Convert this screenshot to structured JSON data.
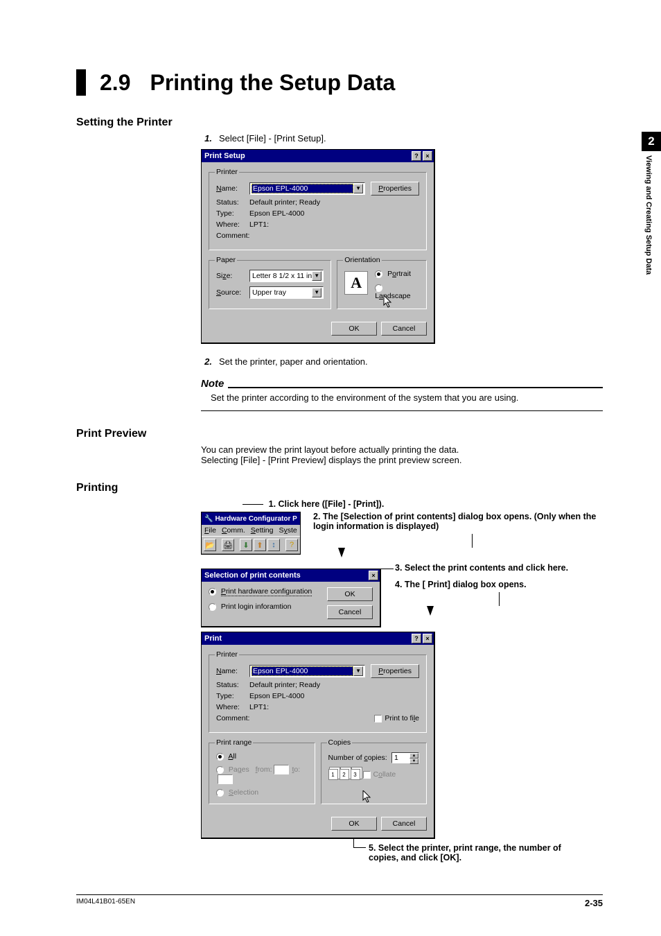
{
  "sidebar": {
    "chapter": "2",
    "chapter_name": "Viewing and Creating Setup Data"
  },
  "heading": {
    "number": "2.9",
    "title": "Printing the Setup Data"
  },
  "setting": {
    "h": "Setting the Printer",
    "step1_num": "1.",
    "step1_txt": "Select [File] - [Print Setup].",
    "step2_num": "2.",
    "step2_txt": "Set the printer, paper and orientation.",
    "note_label": "Note",
    "note_text": "Set the printer according to the environment of the system that you are using."
  },
  "print_setup_dlg": {
    "title": "Print Setup",
    "grp_printer": "Printer",
    "name_lbl": "Name:",
    "name_val": "Epson EPL-4000",
    "status_lbl": "Status:",
    "status_val": "Default printer; Ready",
    "type_lbl": "Type:",
    "type_val": "Epson EPL-4000",
    "where_lbl": "Where:",
    "where_val": "LPT1:",
    "comment_lbl": "Comment:",
    "properties_btn": "Properties",
    "grp_paper": "Paper",
    "size_lbl": "Size:",
    "size_val": "Letter 8 1/2 x 11 in",
    "source_lbl": "Source:",
    "source_val": "Upper tray",
    "grp_orient": "Orientation",
    "orient_glyph": "A",
    "portrait_lbl": "Portrait",
    "landscape_lbl": "Landscape",
    "ok": "OK",
    "cancel": "Cancel",
    "help_btn": "?",
    "close_btn": "×"
  },
  "preview": {
    "h": "Print Preview",
    "p1": "You can preview the print layout before actually printing the data.",
    "p2": "Selecting [File] - [Print Preview] displays the print preview screen."
  },
  "printing": {
    "h": "Printing",
    "c1": "1. Click here ([File] - [Print]).",
    "c2": "2. The [Selection of print contents] dialog box opens. (Only when the login information is displayed)",
    "c3": "3. Select the print contents and click here.",
    "c4": "4. The [ Print] dialog box opens.",
    "c5": "5. Select the printer, print range, the number of copies, and click [OK]."
  },
  "appwin": {
    "title": "Hardware Configurator P",
    "m_file": "File",
    "m_comm": "Comm.",
    "m_setting": "Setting",
    "m_system": "System"
  },
  "sel_dlg": {
    "title": "Selection of print contents",
    "opt1": "Print hardware configuration",
    "opt2": "Print login inforamtion",
    "ok": "OK",
    "cancel": "Cancel",
    "close": "×"
  },
  "print_dlg": {
    "title": "Print",
    "grp_printer": "Printer",
    "name_lbl": "Name:",
    "name_val": "Epson EPL-4000",
    "status_lbl": "Status:",
    "status_val": "Default printer; Ready",
    "type_lbl": "Type:",
    "type_val": "Epson EPL-4000",
    "where_lbl": "Where:",
    "where_val": "LPT1:",
    "comment_lbl": "Comment:",
    "properties_btn": "Properties",
    "print_to_file": "Print to file",
    "grp_range": "Print range",
    "all": "All",
    "pages": "Pages",
    "pages_from": "from:",
    "pages_to": "to:",
    "selection": "Selection",
    "grp_copies": "Copies",
    "num_copies_lbl": "Number of copies:",
    "num_copies_val": "1",
    "collate": "Collate",
    "page_icons": [
      "1",
      "2",
      "3"
    ],
    "ok": "OK",
    "cancel": "Cancel",
    "help_btn": "?",
    "close_btn": "×"
  },
  "footer": {
    "doc": "IM04L41B01-65EN",
    "page": "2-35"
  }
}
